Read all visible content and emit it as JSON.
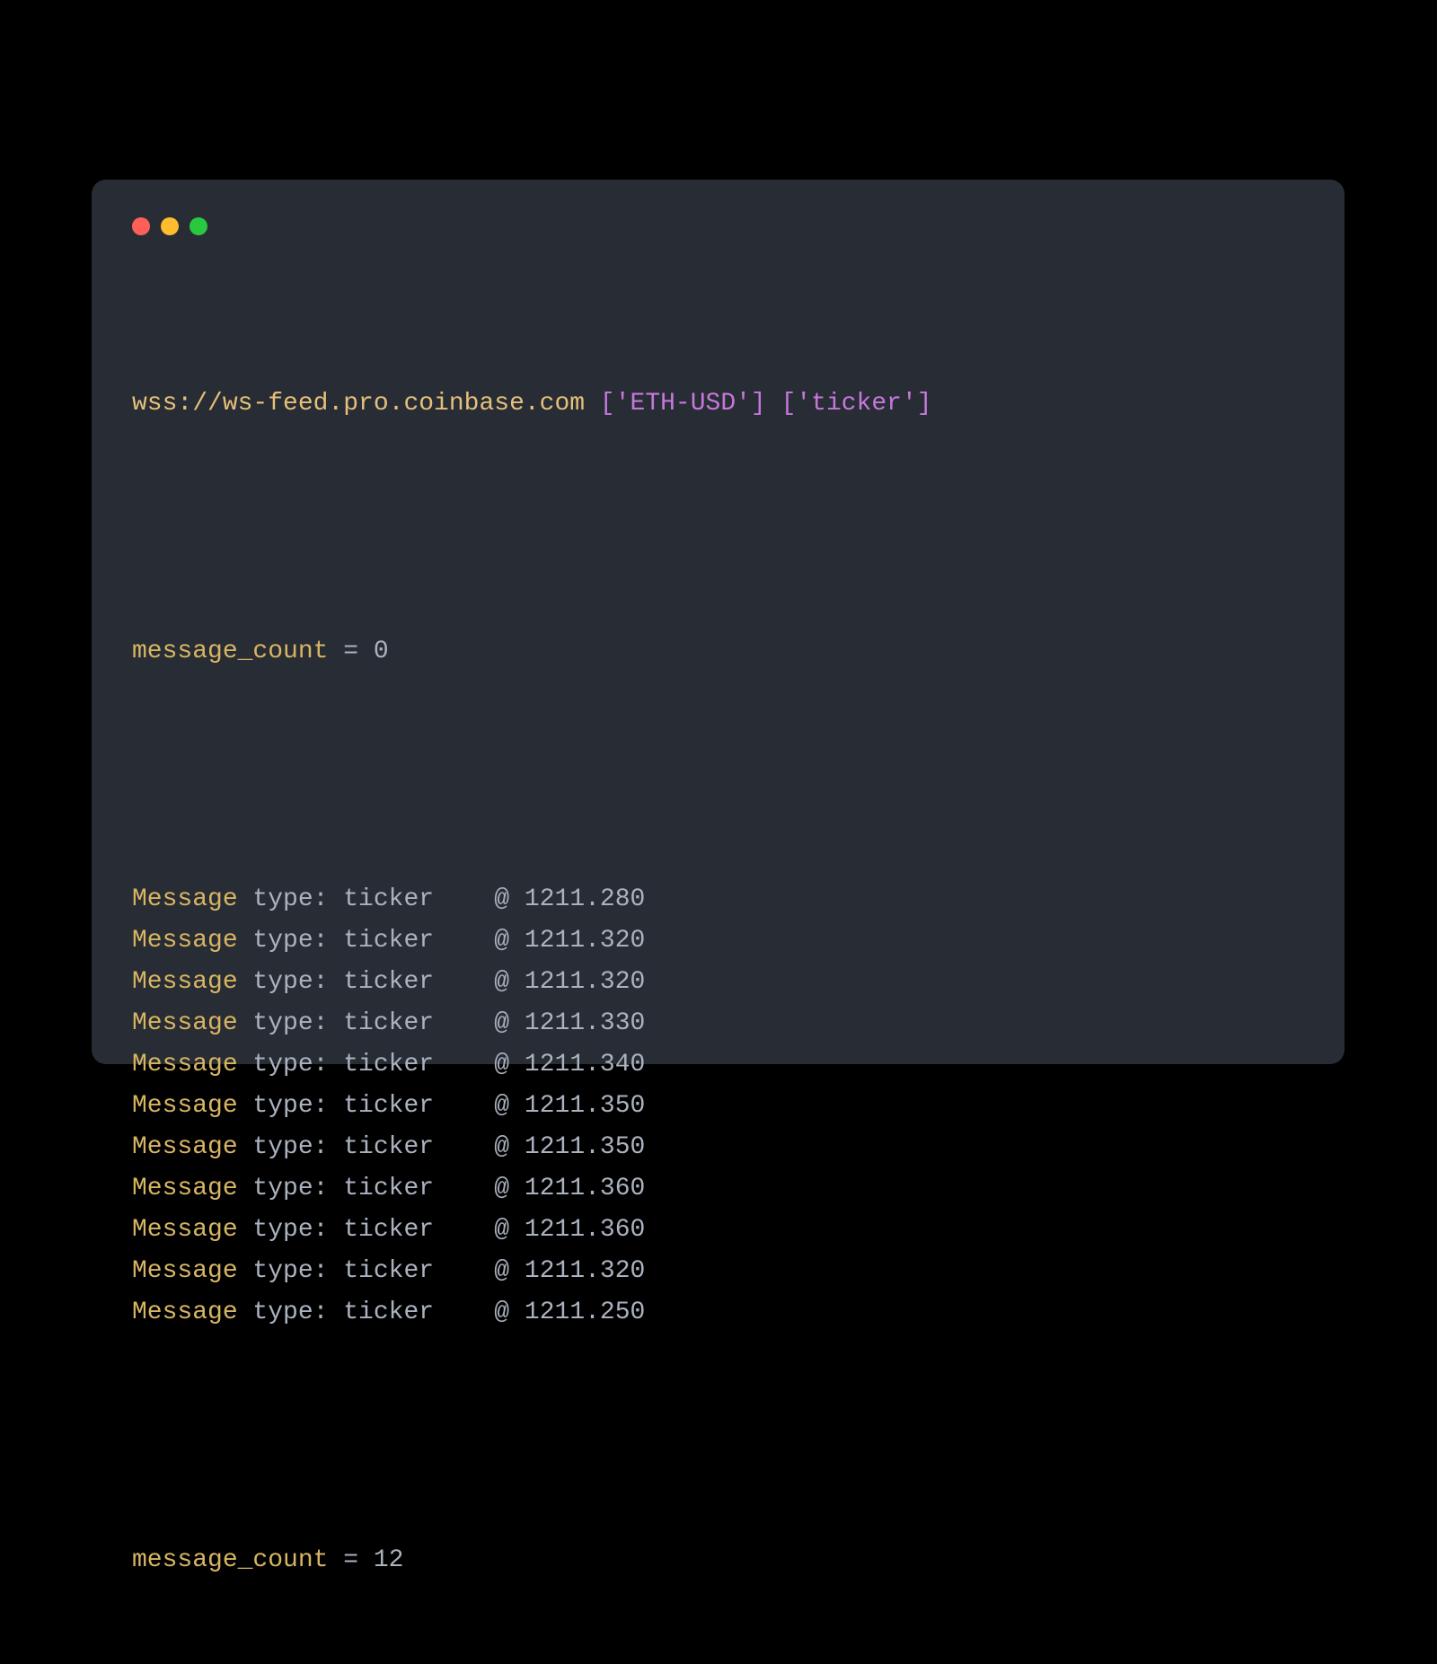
{
  "colors": {
    "close": "#ff5f57",
    "minimize": "#febc2e",
    "zoom": "#28c840"
  },
  "header": {
    "url": "wss://ws-feed.pro.coinbase.com",
    "products": "['ETH-USD']",
    "channels": "['ticker']"
  },
  "count_start": {
    "label": "message_count",
    "eq": " = ",
    "value": "0"
  },
  "msg_label": "Message",
  "type_word": " type: ",
  "type_value": "ticker",
  "at_prefix": "    @ ",
  "prices": [
    "1211.280",
    "1211.320",
    "1211.320",
    "1211.330",
    "1211.340",
    "1211.350",
    "1211.350",
    "1211.360",
    "1211.360",
    "1211.320",
    "1211.250"
  ],
  "count_end": {
    "label": "message_count",
    "eq": " = ",
    "value": "12"
  }
}
